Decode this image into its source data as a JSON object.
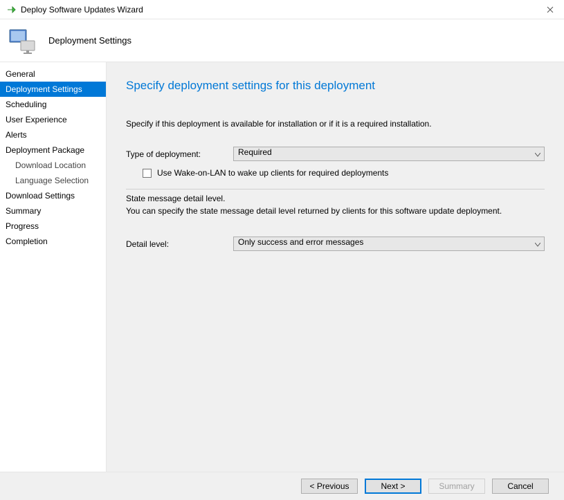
{
  "window": {
    "title": "Deploy Software Updates Wizard"
  },
  "header": {
    "title": "Deployment Settings"
  },
  "sidebar": {
    "items": [
      {
        "label": "General"
      },
      {
        "label": "Deployment Settings"
      },
      {
        "label": "Scheduling"
      },
      {
        "label": "User Experience"
      },
      {
        "label": "Alerts"
      },
      {
        "label": "Deployment Package"
      },
      {
        "label": "Download Location"
      },
      {
        "label": "Language Selection"
      },
      {
        "label": "Download Settings"
      },
      {
        "label": "Summary"
      },
      {
        "label": "Progress"
      },
      {
        "label": "Completion"
      }
    ]
  },
  "main": {
    "heading": "Specify deployment settings for this deployment",
    "instruction": "Specify if this deployment is available for installation or if it is a required installation.",
    "type_label": "Type of deployment:",
    "type_value": "Required",
    "wol_label": "Use Wake-on-LAN to wake up clients for required deployments",
    "state_heading": "State message detail level.",
    "state_desc": "You can specify the state message detail level returned by clients for this software update deployment.",
    "detail_label": "Detail level:",
    "detail_value": "Only success and error messages"
  },
  "footer": {
    "previous": "< Previous",
    "next": "Next >",
    "summary": "Summary",
    "cancel": "Cancel"
  }
}
